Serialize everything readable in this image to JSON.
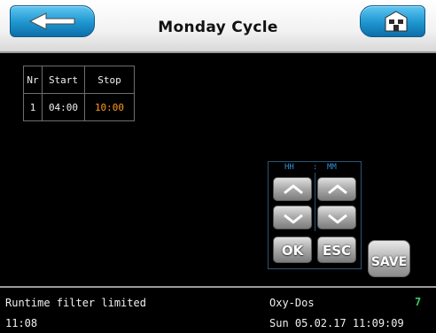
{
  "header": {
    "title": "Monday Cycle",
    "back_icon": "back-arrow-icon",
    "home_icon": "home-icon",
    "accent_color": "#1e95cf"
  },
  "table": {
    "columns": [
      "Nr",
      "Start",
      "Stop"
    ],
    "rows": [
      {
        "nr": "1",
        "start": "04:00",
        "stop": "10:00"
      }
    ],
    "stop_color": "#ff9a1a"
  },
  "keypad": {
    "hh_label": "HH",
    "separator": ":",
    "mm_label": "MM",
    "up_icon": "chevron-up-icon",
    "down_icon": "chevron-down-icon",
    "ok_label": "OK",
    "esc_label": "ESC"
  },
  "save_label": "SAVE",
  "status": {
    "message": "Runtime filter limited",
    "time": "11:08",
    "device": "Oxy-Dos",
    "count": "7",
    "count_color": "#2ed15a",
    "datetime": "Sun 05.02.17 11:09:09"
  }
}
